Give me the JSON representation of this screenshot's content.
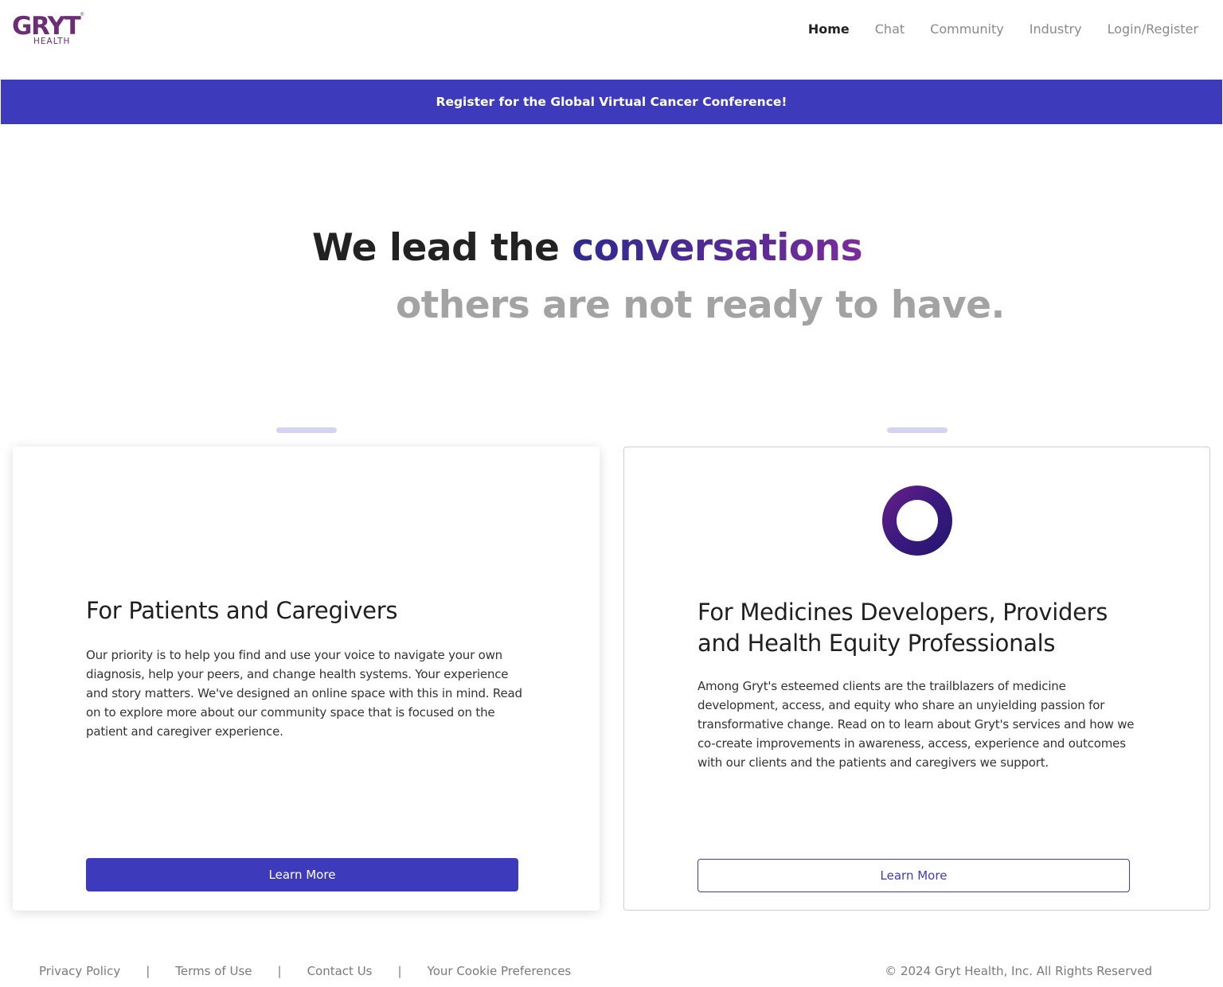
{
  "brand": {
    "name": "GRYT",
    "sub": "HEALTH",
    "tm": "®",
    "color": "#6b2e74"
  },
  "nav": {
    "items": [
      {
        "label": "Home",
        "active": true
      },
      {
        "label": "Chat"
      },
      {
        "label": "Community"
      },
      {
        "label": "Industry"
      },
      {
        "label": "Login/Register"
      }
    ]
  },
  "banner": {
    "text": "Register for the Global Virtual Cancer Conference!",
    "color": "#3d3bbb"
  },
  "hero": {
    "line1_prefix": "We lead the ",
    "line1_accent": "conversations",
    "line2": "others are not ready to have."
  },
  "cards": [
    {
      "title": "For Patients and Caregivers",
      "body": "Our priority is to help you find and use your voice to navigate your own diagnosis, help your peers, and change health systems. Your experience and story matters. We've designed an online space with this in mind. Read on to explore more about our community space that is focused on the patient and caregiver experience.",
      "button": "Learn More"
    },
    {
      "icon": "ring-icon",
      "title": "For Medicines Developers, Providers and Health Equity Professionals",
      "body": "Among Gryt's esteemed clients are the trailblazers of medicine development, access, and equity who share an unyielding passion for transformative change. Read on to learn about Gryt's services and how we co-create improvements in awareness, access, experience and outcomes with our clients and the patients and caregivers we support.",
      "button": "Learn More"
    }
  ],
  "footer": {
    "links": [
      "Privacy Policy",
      "Terms of Use",
      "Contact Us",
      "Your Cookie Preferences"
    ],
    "separator": "|",
    "copyright": "© 2024 Gryt Health, Inc. All Rights Reserved"
  }
}
